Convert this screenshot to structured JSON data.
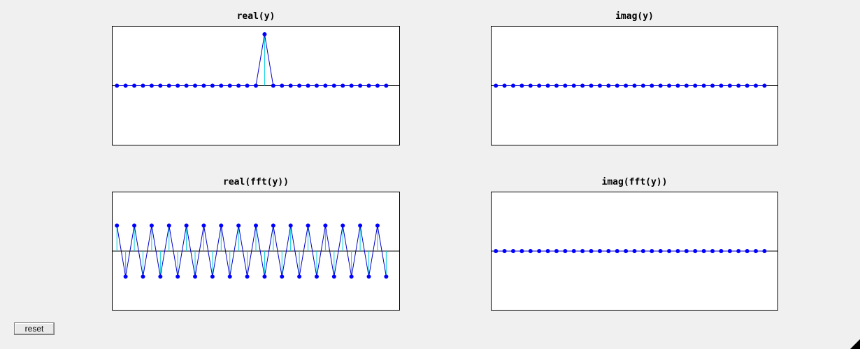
{
  "controls": {
    "reset_label": "reset"
  },
  "colors": {
    "stem": "#00d0e0",
    "line": "#0000c8",
    "marker": "#0000ff",
    "baseline": "#000000"
  },
  "chart_data": [
    {
      "id": "real-y",
      "type": "line",
      "title": "real(y)",
      "xlim": [
        0.5,
        33.5
      ],
      "ylim": [
        -1.15,
        1.15
      ],
      "x": [
        1,
        2,
        3,
        4,
        5,
        6,
        7,
        8,
        9,
        10,
        11,
        12,
        13,
        14,
        15,
        16,
        17,
        18,
        19,
        20,
        21,
        22,
        23,
        24,
        25,
        26,
        27,
        28,
        29,
        30,
        31,
        32
      ],
      "series": [
        {
          "values": [
            0,
            0,
            0,
            0,
            0,
            0,
            0,
            0,
            0,
            0,
            0,
            0,
            0,
            0,
            0,
            0,
            0,
            1,
            0,
            0,
            0,
            0,
            0,
            0,
            0,
            0,
            0,
            0,
            0,
            0,
            0,
            0
          ]
        }
      ],
      "grid": false
    },
    {
      "id": "imag-y",
      "type": "line",
      "title": "imag(y)",
      "xlim": [
        0.5,
        33.5
      ],
      "ylim": [
        -1.15,
        1.15
      ],
      "x": [
        1,
        2,
        3,
        4,
        5,
        6,
        7,
        8,
        9,
        10,
        11,
        12,
        13,
        14,
        15,
        16,
        17,
        18,
        19,
        20,
        21,
        22,
        23,
        24,
        25,
        26,
        27,
        28,
        29,
        30,
        31,
        32
      ],
      "series": [
        {
          "values": [
            0,
            0,
            0,
            0,
            0,
            0,
            0,
            0,
            0,
            0,
            0,
            0,
            0,
            0,
            0,
            0,
            0,
            0,
            0,
            0,
            0,
            0,
            0,
            0,
            0,
            0,
            0,
            0,
            0,
            0,
            0,
            0
          ]
        }
      ],
      "grid": false
    },
    {
      "id": "real-fft-y",
      "type": "line",
      "title": "real(fft(y))",
      "xlim": [
        0.5,
        33.5
      ],
      "ylim": [
        -2.3,
        2.3
      ],
      "x": [
        1,
        2,
        3,
        4,
        5,
        6,
        7,
        8,
        9,
        10,
        11,
        12,
        13,
        14,
        15,
        16,
        17,
        18,
        19,
        20,
        21,
        22,
        23,
        24,
        25,
        26,
        27,
        28,
        29,
        30,
        31,
        32
      ],
      "series": [
        {
          "values": [
            1,
            -1,
            1,
            -1,
            1,
            -1,
            1,
            -1,
            1,
            -1,
            1,
            -1,
            1,
            -1,
            1,
            -1,
            1,
            -1,
            1,
            -1,
            1,
            -1,
            1,
            -1,
            1,
            -1,
            1,
            -1,
            1,
            -1,
            1,
            -1
          ]
        }
      ],
      "grid": false
    },
    {
      "id": "imag-fft-y",
      "type": "line",
      "title": "imag(fft(y))",
      "xlim": [
        0.5,
        33.5
      ],
      "ylim": [
        -1.15,
        1.15
      ],
      "x": [
        1,
        2,
        3,
        4,
        5,
        6,
        7,
        8,
        9,
        10,
        11,
        12,
        13,
        14,
        15,
        16,
        17,
        18,
        19,
        20,
        21,
        22,
        23,
        24,
        25,
        26,
        27,
        28,
        29,
        30,
        31,
        32
      ],
      "series": [
        {
          "values": [
            0,
            0,
            0,
            0,
            0,
            0,
            0,
            0,
            0,
            0,
            0,
            0,
            0,
            0,
            0,
            0,
            0,
            0,
            0,
            0,
            0,
            0,
            0,
            0,
            0,
            0,
            0,
            0,
            0,
            0,
            0,
            0
          ]
        }
      ],
      "grid": false
    }
  ]
}
